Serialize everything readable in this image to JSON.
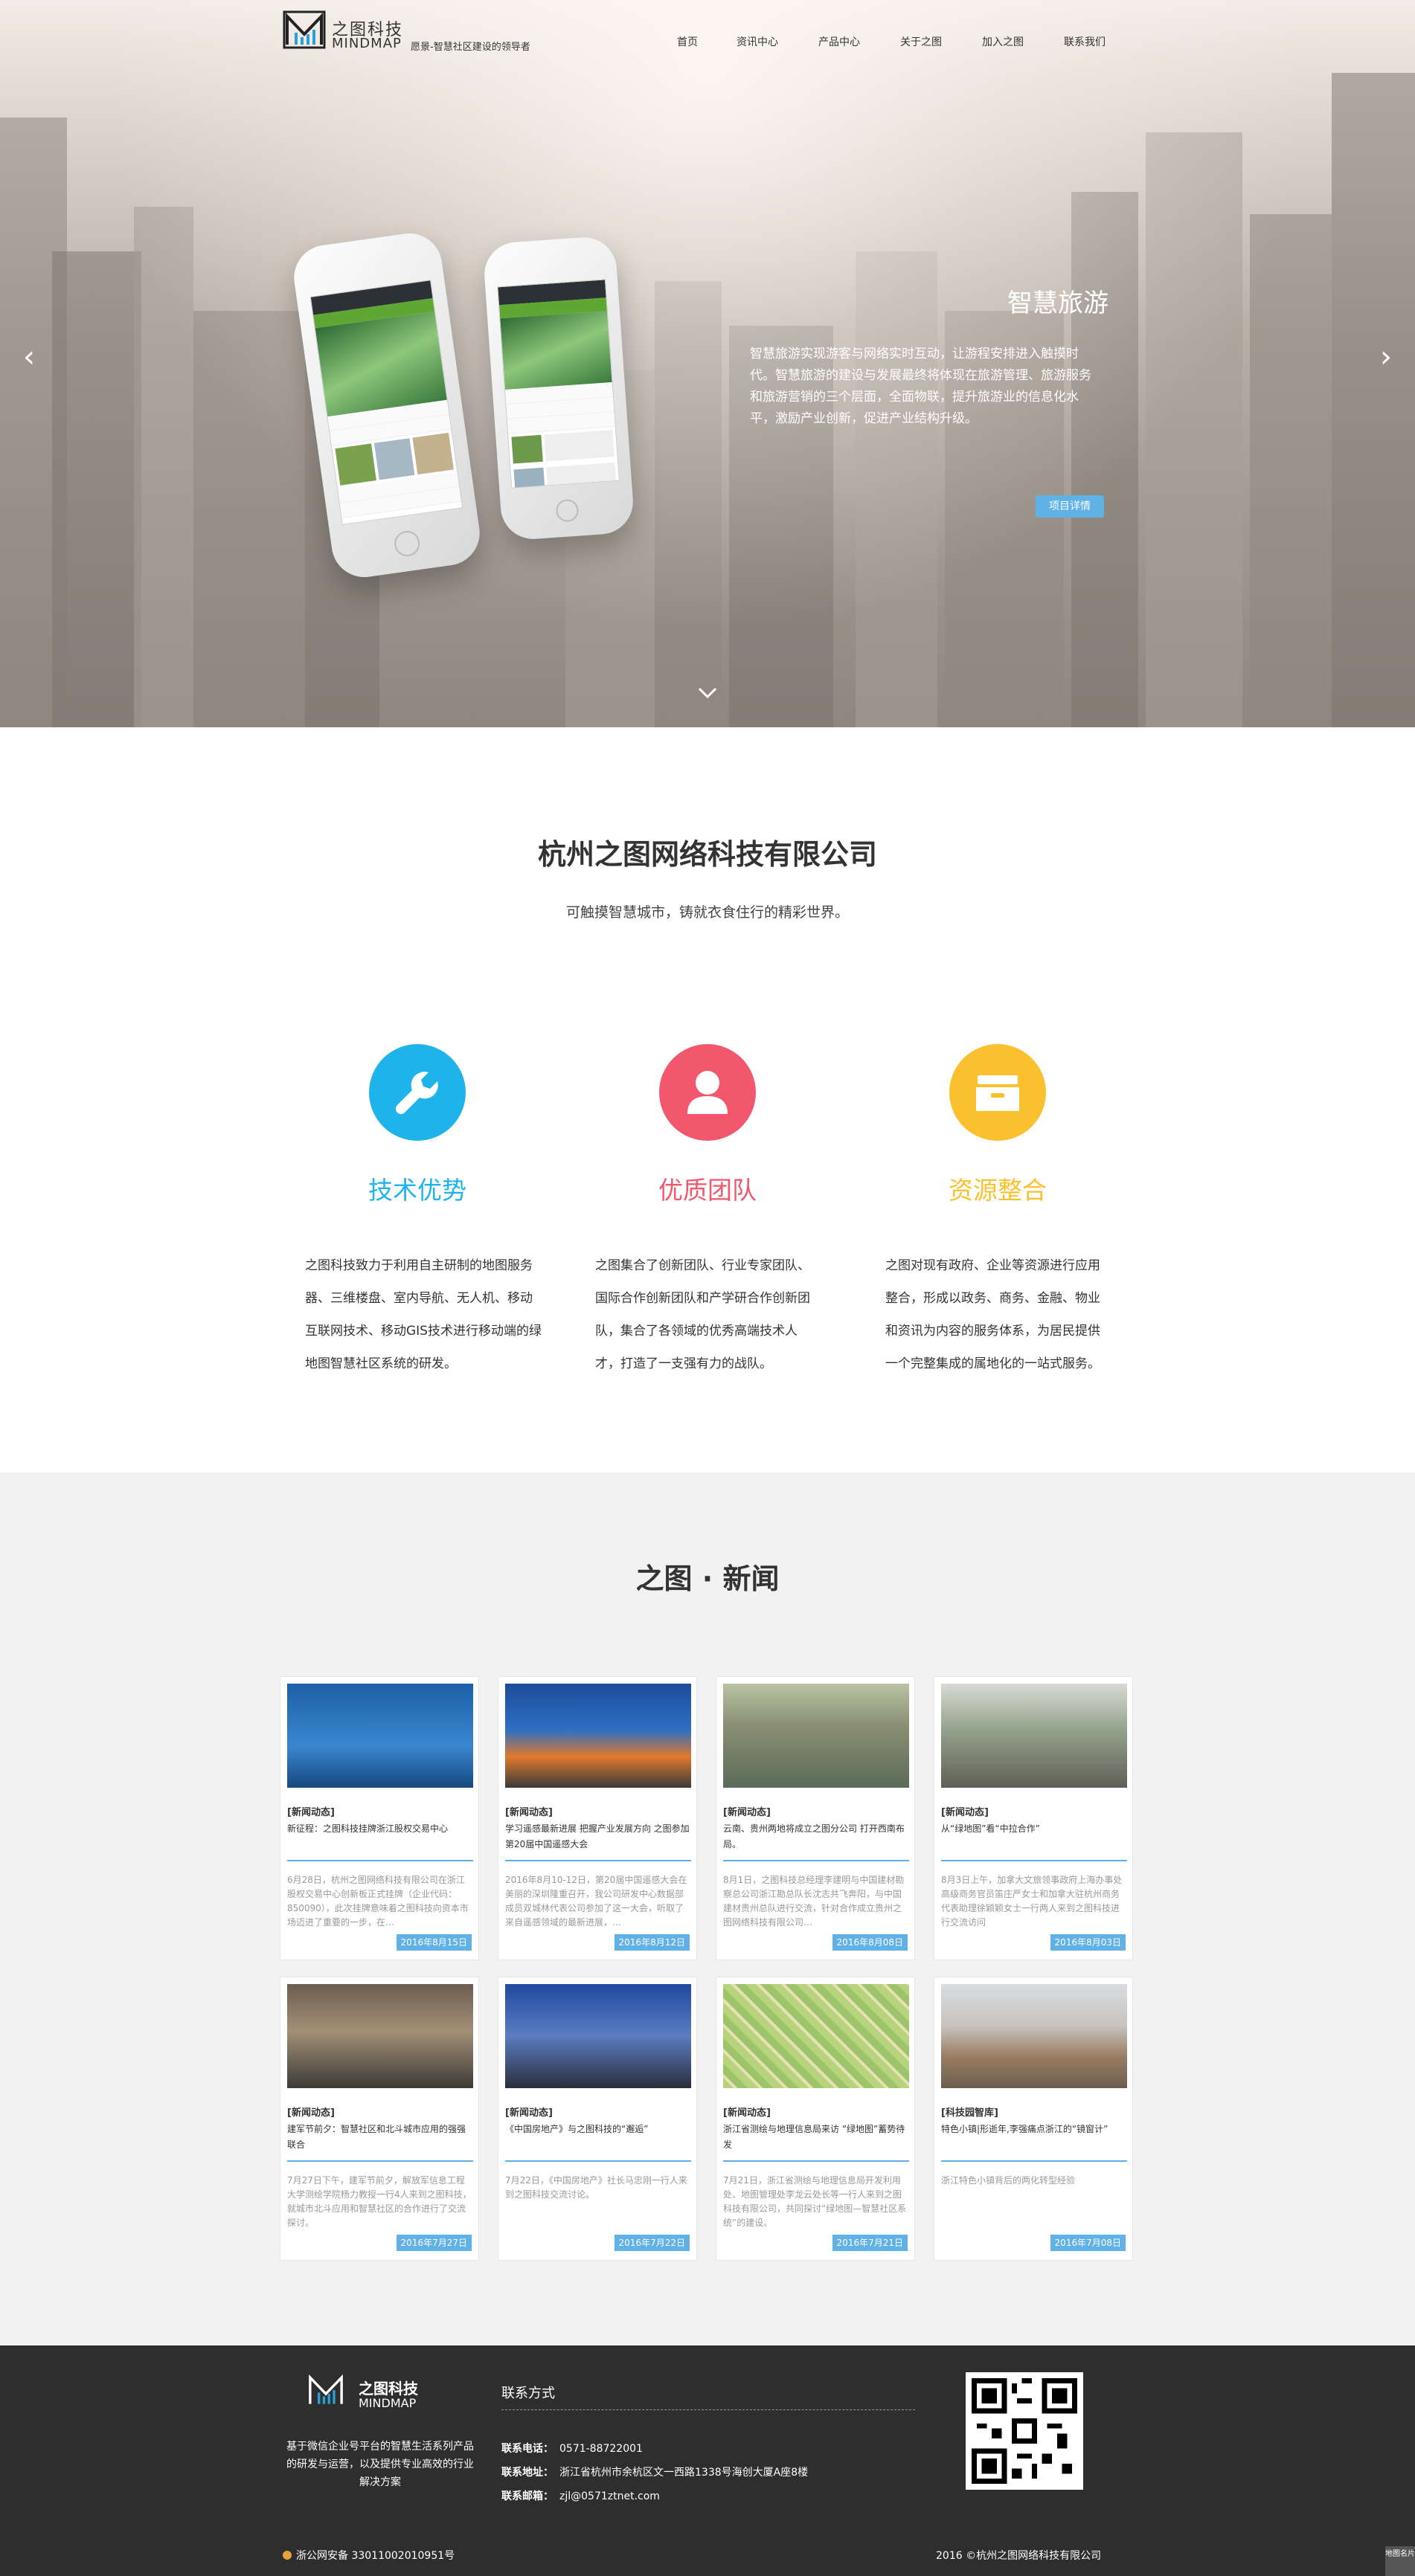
{
  "header": {
    "logo_cn": "之图科技",
    "logo_en": "MINDMAP",
    "slogan": "愿景-智慧社区建设的领导者",
    "nav": [
      {
        "label": "首页"
      },
      {
        "label": "资讯中心"
      },
      {
        "label": "产品中心"
      },
      {
        "label": "关于之图"
      },
      {
        "label": "加入之图"
      },
      {
        "label": "联系我们"
      }
    ]
  },
  "hero": {
    "title": "智慧旅游",
    "description": "智慧旅游实现游客与网络实时互动，让游程安排进入触摸时代。智慧旅游的建设与发展最终将体现在旅游管理、旅游服务和旅游营销的三个层面，全面物联，提升旅游业的信息化水平，激励产业创新，促进产业结构升级。",
    "button": "项目详情",
    "prev_icon": "‹",
    "next_icon": "›"
  },
  "intro": {
    "title": "杭州之图网络科技有限公司",
    "subtitle": "可触摸智慧城市，铸就衣食住行的精彩世界。"
  },
  "features": [
    {
      "title": "技术优势",
      "color": "#1fb3ec",
      "icon": "wrench-icon",
      "text": "之图科技致力于利用自主研制的地图服务器、三维楼盘、室内导航、无人机、移动互联网技术、移动GIS技术进行移动端的绿地图智慧社区系统的研发。"
    },
    {
      "title": "优质团队",
      "color": "#f2576d",
      "icon": "person-icon",
      "text": "之图集合了创新团队、行业专家团队、国际合作创新团队和产学研合作创新团队，集合了各领域的优秀高端技术人才，打造了一支强有力的战队。"
    },
    {
      "title": "资源整合",
      "color": "#fbc02d",
      "icon": "archive-icon",
      "text": "之图对现有政府、企业等资源进行应用整合，形成以政务、商务、金融、物业和资讯为内容的服务体系，为居民提供一个完整集成的属地化的一站式服务。"
    }
  ],
  "news": {
    "title": "之图 · 新闻",
    "items": [
      {
        "category": "[新闻动态]",
        "headline": "新征程：之图科技挂牌浙江股权交易中心",
        "excerpt": "6月28日，杭州之图网络科技有限公司在浙江股权交易中心创新板正式挂牌（企业代码：850090），此次挂牌意味着之图科技向资本市场迈进了重要的一步，在…",
        "date": "2016年8月15日",
        "img": "banner"
      },
      {
        "category": "[新闻动态]",
        "headline": "学习遥感最新进展 把握产业发展方向 之图参加第20届中国遥感大会",
        "excerpt": "2016年8月10-12日，第20届中国遥感大会在美丽的深圳隆重召开，我公司研发中心数据部成员双城林代表公司参加了这一大会，听取了来自遥感领域的最新进展，…",
        "date": "2016年8月12日",
        "img": "conference"
      },
      {
        "category": "[新闻动态]",
        "headline": "云南、贵州两地将成立之图分公司 打开西南布局。",
        "excerpt": "8月1日，之图科技总经理李建明与中国建材勘察总公司浙江勘总队长沈志共飞奔阳，与中国建材贵州总队进行交流，针对合作成立贵州之图网络科技有限公司…",
        "date": "2016年8月08日",
        "img": "meeting"
      },
      {
        "category": "[新闻动态]",
        "headline": "从“绿地图”看“中拉合作”",
        "excerpt": "8月3日上午，加拿大文旅领事政府上海办事处高级商务官员笛庄严女士和加拿大驻杭州商务代表助理徐颖颖女士一行两人来到之图科技进行交流访问",
        "date": "2016年8月03日",
        "img": "meeting2"
      },
      {
        "category": "[新闻动态]",
        "headline": "建军节前夕：智慧社区和北斗城市应用的强强联合",
        "excerpt": "7月27日下午，建军节前夕，解放军信息工程大学测绘学院杨力教授一行4人来到之图科技，就城市北斗应用和智慧社区的合作进行了交流探讨。",
        "date": "2016年7月27日",
        "img": "office"
      },
      {
        "category": "[新闻动态]",
        "headline": "《中国房地产》与之图科技的“邂逅”",
        "excerpt": "7月22日，《中国房地产》社长马忠刚一行人来到之图科技交流讨论。",
        "date": "2016年7月22日",
        "img": "people"
      },
      {
        "category": "[新闻动态]",
        "headline": "浙江省测绘与地理信息局来访 “绿地图”蓄势待发",
        "excerpt": "7月21日，浙江省测绘与地理信息局开发利用处、地图管理处李龙云处长等一行人来到之图科技有限公司，共同探讨“绿地图—智慧社区系统”的建设。",
        "date": "2016年7月21日",
        "img": "map"
      },
      {
        "category": "[科技园智库]",
        "headline": "特色小镇|形逝年,李强痛点浙江的“镜窗计”",
        "excerpt": "浙江特色小镇背后的两化转型经验",
        "date": "2016年7月08日",
        "img": "street"
      }
    ]
  },
  "footer": {
    "logo_cn": "之图科技",
    "logo_en": "MINDMAP",
    "description": "基于微信企业号平台的智慧生活系列产品的研发与运营，以及提供专业高效的行业解决方案",
    "contact_title": "联系方式",
    "contacts": [
      {
        "label": "联系电话：",
        "value": "0571-88722001"
      },
      {
        "label": "联系地址：",
        "value": "浙江省杭州市余杭区文一西路1338号海创大厦A座8楼"
      },
      {
        "label": "联系邮箱：",
        "value": "zjl@0571ztnet.com"
      }
    ],
    "icp": "浙公网安备 33011002010951号",
    "copyright": "2016 ©杭州之图网络科技有限公司",
    "side_badge": "地图名片"
  }
}
